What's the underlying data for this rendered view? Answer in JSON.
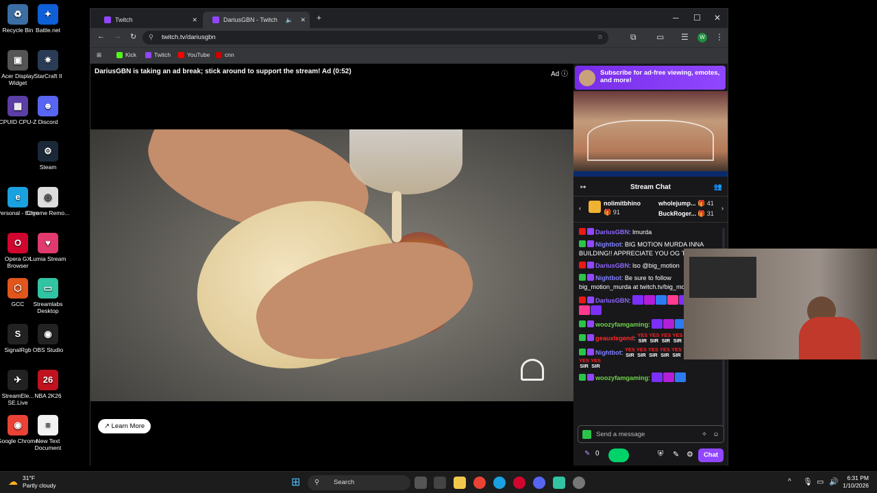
{
  "desktop": {
    "icons": [
      {
        "label": "Recycle Bin",
        "color": "#3a6ea5",
        "glyph": "♻"
      },
      {
        "label": "Battle.net",
        "color": "#0f5fd6",
        "glyph": "✦"
      },
      {
        "label": "Acer Display Widget",
        "color": "#555555",
        "glyph": "▣"
      },
      {
        "label": "StarCraft II",
        "color": "#2a3b55",
        "glyph": "✷"
      },
      {
        "label": "CPUID CPU-Z",
        "color": "#5b3ea6",
        "glyph": "▦"
      },
      {
        "label": "Discord",
        "color": "#5865f2",
        "glyph": "☻"
      },
      {
        "label": "Steam",
        "color": "#1b2838",
        "glyph": "⚙"
      },
      {
        "label": "Personal - Edge",
        "color": "#1aa1e0",
        "glyph": "e"
      },
      {
        "label": "Chrome Remo...",
        "color": "#dddddd",
        "glyph": "◎"
      },
      {
        "label": "Opera GX Browser",
        "color": "#d1062f",
        "glyph": "O"
      },
      {
        "label": "Lumia Stream",
        "color": "#e03a6f",
        "glyph": "♥"
      },
      {
        "label": "GCC",
        "color": "#e0561c",
        "glyph": "⬡"
      },
      {
        "label": "Streamlabs Desktop",
        "color": "#31c3a2",
        "glyph": "▭"
      },
      {
        "label": "SignalRgb",
        "color": "#222222",
        "glyph": "S"
      },
      {
        "label": "OBS Studio",
        "color": "#222222",
        "glyph": "◉"
      },
      {
        "label": "StreamEle... SE.Live",
        "color": "#222222",
        "glyph": "✈"
      },
      {
        "label": "NBA 2K26",
        "color": "#c1121f",
        "glyph": "26"
      },
      {
        "label": "Google Chrome",
        "color": "#ea4335",
        "glyph": "◉"
      },
      {
        "label": "New Text Document",
        "color": "#f2f2f2",
        "glyph": "≡"
      }
    ]
  },
  "browser": {
    "tabs": [
      {
        "title": "Twitch"
      },
      {
        "title": "DariusGBN - Twitch"
      }
    ],
    "url": "twitch.tv/dariusgbn",
    "bookmarks": [
      {
        "label": "Kick",
        "color": "#53fc18"
      },
      {
        "label": "Twitch",
        "color": "#9146ff"
      },
      {
        "label": "YouTube",
        "color": "#ff0000"
      },
      {
        "label": "cnn",
        "color": "#cc0000"
      }
    ],
    "profile_initial": "W"
  },
  "player": {
    "ad_text": "DariusGBN is taking an ad break; stick around to support the stream! Ad (0:52)",
    "ad_badge": "Ad",
    "learn_more": "Learn More"
  },
  "sidebar": {
    "promo": "Subscribe for ad-free viewing, emotes, and more!",
    "chat_title": "Stream Chat",
    "gifters": [
      {
        "name": "nolimitbhino",
        "count": "91"
      },
      {
        "name": "wholejump...",
        "count": "41"
      },
      {
        "name": "BuckRoger...",
        "count": "31"
      }
    ],
    "messages": [
      {
        "user": "DariusGBN",
        "cls": "u-darius",
        "text": "lmurda"
      },
      {
        "user": "Nightbot",
        "cls": "u-night",
        "text": "BIG MOTION MURDA INNA BUILDING!! APPRECIATE YOU OG T OG"
      },
      {
        "user": "DariusGBN",
        "cls": "u-darius",
        "text": "lso @big_motion"
      },
      {
        "user": "Nightbot",
        "cls": "u-night",
        "text": "Be sure to follow big_motion_murda at twitch.tv/big_motion_murda"
      },
      {
        "user": "DariusGBN",
        "cls": "u-darius",
        "text": ""
      },
      {
        "user": "woozyfamgaming",
        "cls": "u-woozy",
        "text": ""
      },
      {
        "user": "geauxlegend",
        "cls": "u-geaux",
        "text": ""
      },
      {
        "user": "Nightbot",
        "cls": "u-night",
        "text": ""
      },
      {
        "user": "woozyfamgaming",
        "cls": "u-woozy",
        "text": ""
      }
    ],
    "yes_top": "YES",
    "yes_bottom": "SIR",
    "input_placeholder": "Send a message",
    "points": "0",
    "chat_button": "Chat"
  },
  "taskbar": {
    "temperature": "31°F",
    "weather": "Partly cloudy",
    "search": "Search",
    "time": "6:31 PM",
    "date": "1/10/2026"
  }
}
